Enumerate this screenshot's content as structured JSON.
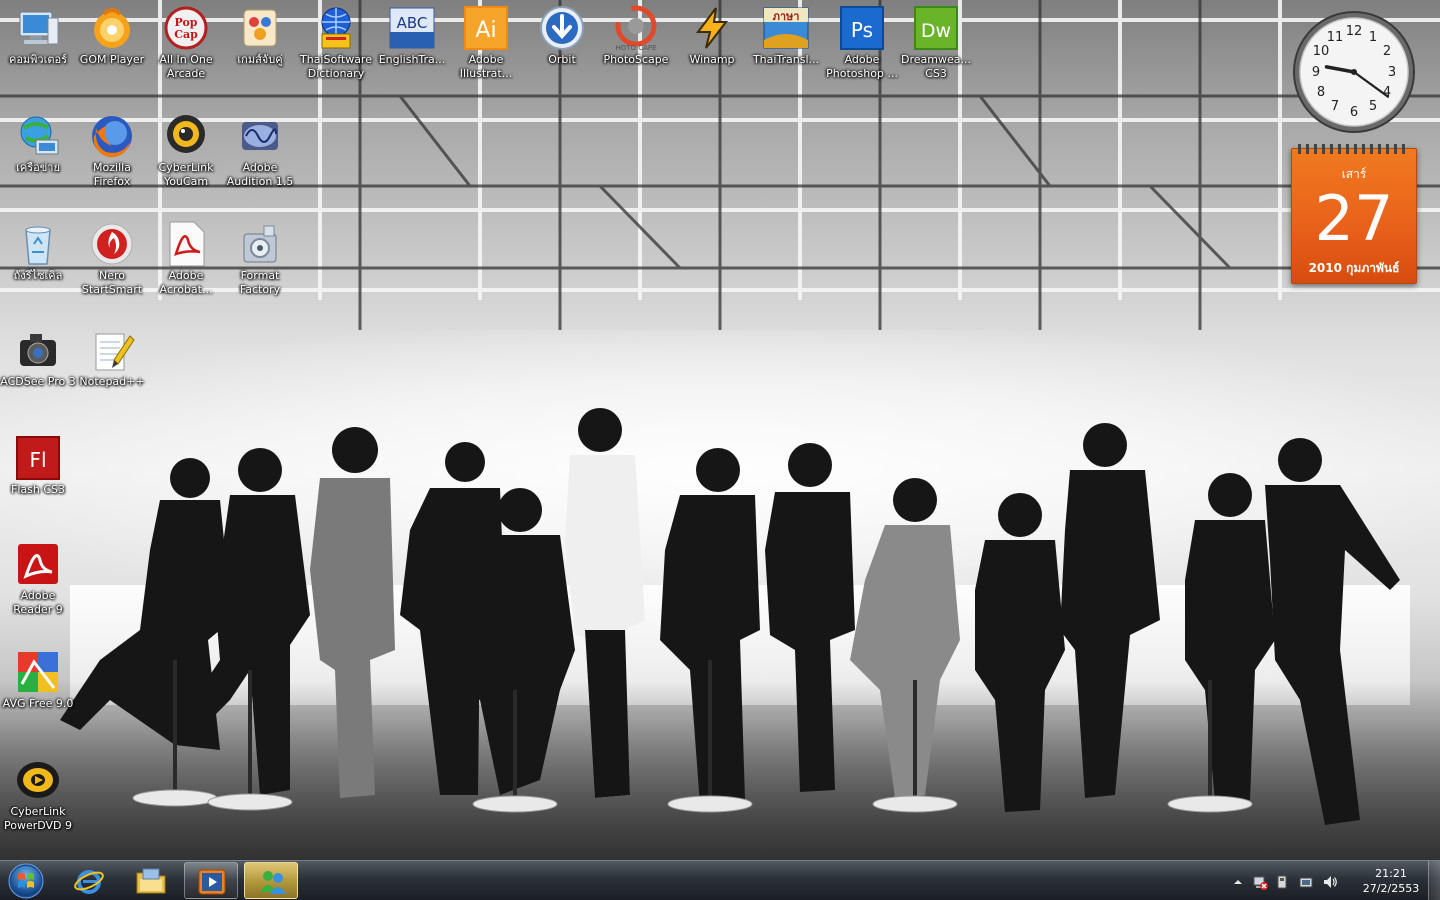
{
  "desktop": {
    "icons": [
      {
        "label": "คอมพิวเตอร์",
        "icon": "computer-icon"
      },
      {
        "label": "GOM Player",
        "icon": "gom-player-icon"
      },
      {
        "label": "All In One Arcade",
        "icon": "popcap-icon"
      },
      {
        "label": "เกมส์จับคู่",
        "icon": "mahjong-game-icon"
      },
      {
        "label": "ThaiSoftware Dictionary",
        "icon": "dictionary-globe-icon"
      },
      {
        "label": "EnglishTra...",
        "icon": "abc-translator-icon"
      },
      {
        "label": "Adobe Illustrat...",
        "icon": "illustrator-icon"
      },
      {
        "label": "Orbit",
        "icon": "orbit-download-icon"
      },
      {
        "label": "PhotoScape",
        "icon": "photoscape-icon"
      },
      {
        "label": "Winamp",
        "icon": "winamp-icon"
      },
      {
        "label": "ThaiTransl...",
        "icon": "thai-translator-icon"
      },
      {
        "label": "Adobe Photoshop ...",
        "icon": "photoshop-icon"
      },
      {
        "label": "Dreamwea... CS3",
        "icon": "dreamweaver-icon"
      },
      {
        "label": "เครือข่าย",
        "icon": "network-icon"
      },
      {
        "label": "Mozilla Firefox",
        "icon": "firefox-icon"
      },
      {
        "label": "CyberLink YouCam",
        "icon": "youcam-icon"
      },
      {
        "label": "Adobe Audition 1.5",
        "icon": "audition-icon"
      },
      {
        "label": "ถังรีไซเคิล",
        "icon": "recycle-bin-icon"
      },
      {
        "label": "Nero StartSmart",
        "icon": "nero-icon"
      },
      {
        "label": "Adobe Acrobat...",
        "icon": "acrobat-icon"
      },
      {
        "label": "Format Factory",
        "icon": "format-factory-icon"
      },
      {
        "label": "ACDSee Pro 3",
        "icon": "acdsee-icon"
      },
      {
        "label": "Notepad++",
        "icon": "notepad-plus-icon"
      },
      {
        "label": "Flash CS3",
        "icon": "flash-icon"
      },
      {
        "label": "Adobe Reader 9",
        "icon": "adobe-reader-icon"
      },
      {
        "label": "AVG Free 9.0",
        "icon": "avg-icon"
      },
      {
        "label": "CyberLink PowerDVD 9",
        "icon": "powerdvd-icon"
      }
    ]
  },
  "clock_gadget": {
    "numbers": [
      "12",
      "1",
      "2",
      "3",
      "4",
      "5",
      "6",
      "7",
      "8",
      "9",
      "10",
      "11"
    ],
    "time": "21:21"
  },
  "calendar_gadget": {
    "weekday": "เสาร์",
    "day": "27",
    "month_year": "2010 กุมภาพันธ์"
  },
  "taskbar": {
    "start_icon": "windows-orb-icon",
    "pinned": [
      {
        "name": "internet-explorer",
        "icon": "internet-explorer-icon"
      },
      {
        "name": "windows-explorer",
        "icon": "folder-icon"
      },
      {
        "name": "media-player",
        "icon": "media-player-icon"
      },
      {
        "name": "messenger",
        "icon": "messenger-icon"
      }
    ],
    "tray": {
      "time": "21:21",
      "date": "27/2/2553"
    }
  },
  "colors": {
    "calendar_orange": "#e8601a",
    "taskbar_dark": "#1c2128",
    "label_white": "#ffffff"
  }
}
